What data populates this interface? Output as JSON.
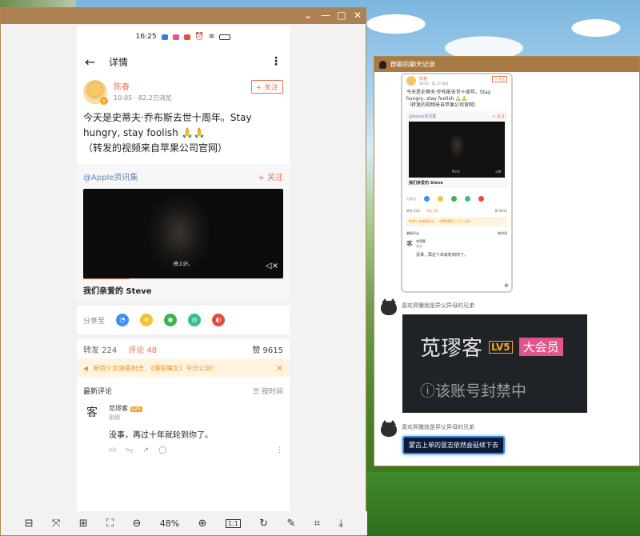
{
  "viewer": {
    "window_controls": [
      "⌄",
      "—",
      "□",
      "✕"
    ],
    "phone": {
      "status_time": "16:25",
      "appbar_title": "详情",
      "post": {
        "user_name": "陈春",
        "user_meta": "10-05 · 82.2万浏览",
        "follow_label": "+ 关注",
        "text_line1": "今天是史蒂夫·乔布斯去世十周年。Stay",
        "text_line2": "hungry, stay foolish 🙏🙏",
        "text_line3": "（转发的视频来自苹果公司官网）"
      },
      "retweet": {
        "name": "@Apple资讯集",
        "follow_label": "+ 关注",
        "video_subtitle": "晚上好。",
        "video_progress": 0.23,
        "caption": "我们亲爱的 Steve"
      },
      "share_label": "分享至",
      "tabs": {
        "repost": "转发 224",
        "comment": "评论 48",
        "like": "赞 9615"
      },
      "notice": {
        "text": "新特少女弹幕射击，《爆裂魔女》今日公测！"
      },
      "comments_header": {
        "title": "最新评论",
        "sort": "☰ 按时间"
      },
      "comment": {
        "avatar_char": "客",
        "name": "苋璆客",
        "level": "LV5",
        "time": "刚刚",
        "text": "没事，再过十年就轮到你了。"
      }
    },
    "toolbar": {
      "zoom": "48%",
      "one_to_one": "1:1"
    }
  },
  "chat": {
    "title": "群聊的聊天记录",
    "thumbnail": {
      "name": "陈春",
      "meta": "10-05 · 82.2万浏览",
      "follow": "+ 关注",
      "text1": "今天是史蒂夫·乔布斯去世十周年。Stay",
      "text2": "hungry, stay foolish 🙏🙏",
      "text3": "（转发的视频来自苹果公司官网）",
      "rt_name": "@Apple资讯集",
      "rt_follow": "+ 关注",
      "subtitle": "晚上好。",
      "caption": "我们亲爱的 Steve",
      "share": "分享至",
      "tab_repost": "转发 224",
      "tab_comment": "评论 48",
      "tab_like": "赞 9615",
      "notice": "新特少女弹幕射击，《爆裂魔女》今日公测！",
      "ch_title": "最新评论",
      "ch_sort": "按时间",
      "c_av": "客",
      "c_name": "苋璆客",
      "c_time": "刚刚",
      "c_text": "没事，再过十年就轮到你了。"
    },
    "msg1_sender": "喜欢昇騰就是异父异母的兄弟",
    "card": {
      "name": "苋璆客",
      "level": "LV5",
      "vip": "大会员",
      "ban": "ⓘ该账号封禁中"
    },
    "msg2_sender": "喜欢昇騰就是异父异母的兄弟",
    "msg2_text": "蒙古上单的意志依然会延续下去"
  },
  "colors": {
    "accent": "#eb7350",
    "link": "#5b87c3",
    "frame": "#ad8151"
  }
}
